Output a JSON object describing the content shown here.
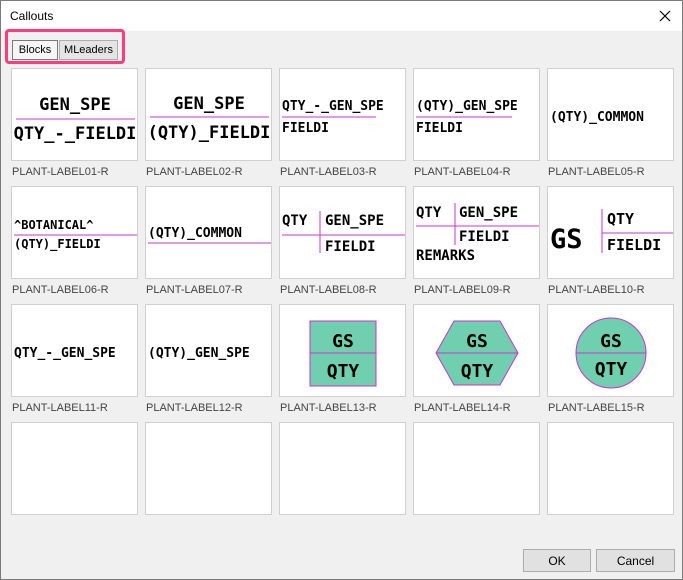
{
  "window": {
    "title": "Callouts"
  },
  "tabs": [
    {
      "label": "Blocks",
      "active": true
    },
    {
      "label": "MLeaders",
      "active": false
    }
  ],
  "items": [
    {
      "caption": "PLANT-LABEL01-R",
      "lines": [
        "GEN_SPE",
        "QTY_-_FIELDI"
      ]
    },
    {
      "caption": "PLANT-LABEL02-R",
      "lines": [
        "GEN_SPE",
        "(QTY)_FIELDI"
      ]
    },
    {
      "caption": "PLANT-LABEL03-R",
      "lines": [
        "QTY_-_GEN_SPE",
        "FIELDI"
      ]
    },
    {
      "caption": "PLANT-LABEL04-R",
      "lines": [
        "(QTY)_GEN_SPE",
        "FIELDI"
      ]
    },
    {
      "caption": "PLANT-LABEL05-R",
      "lines": [
        "(QTY)_COMMON"
      ]
    },
    {
      "caption": "PLANT-LABEL06-R",
      "lines": [
        "^BOTANICAL^",
        "(QTY)_FIELDI"
      ]
    },
    {
      "caption": "PLANT-LABEL07-R",
      "lines": [
        "(QTY)_COMMON"
      ]
    },
    {
      "caption": "PLANT-LABEL08-R",
      "lines": [
        "QTY",
        "GEN_SPE",
        "FIELDI"
      ]
    },
    {
      "caption": "PLANT-LABEL09-R",
      "lines": [
        "QTY",
        "GEN_SPE",
        "FIELDI",
        "REMARKS"
      ]
    },
    {
      "caption": "PLANT-LABEL10-R",
      "lines": [
        "GS",
        "QTY",
        "FIELDI"
      ]
    },
    {
      "caption": "PLANT-LABEL11-R",
      "lines": [
        "QTY_-_GEN_SPE"
      ]
    },
    {
      "caption": "PLANT-LABEL12-R",
      "lines": [
        "(QTY)_GEN_SPE"
      ]
    },
    {
      "caption": "PLANT-LABEL13-R",
      "lines": [
        "GS",
        "QTY"
      ]
    },
    {
      "caption": "PLANT-LABEL14-R",
      "lines": [
        "GS",
        "QTY"
      ]
    },
    {
      "caption": "PLANT-LABEL15-R",
      "lines": [
        "GS",
        "QTY"
      ]
    },
    {
      "caption": "",
      "lines": []
    },
    {
      "caption": "",
      "lines": []
    },
    {
      "caption": "",
      "lines": []
    },
    {
      "caption": "",
      "lines": []
    },
    {
      "caption": "",
      "lines": []
    }
  ],
  "buttons": {
    "ok": "OK",
    "cancel": "Cancel"
  },
  "colors": {
    "leader_line": "#cc33cc",
    "shape_fill": "#6fcfaf",
    "highlight": "#ff3c7d"
  }
}
